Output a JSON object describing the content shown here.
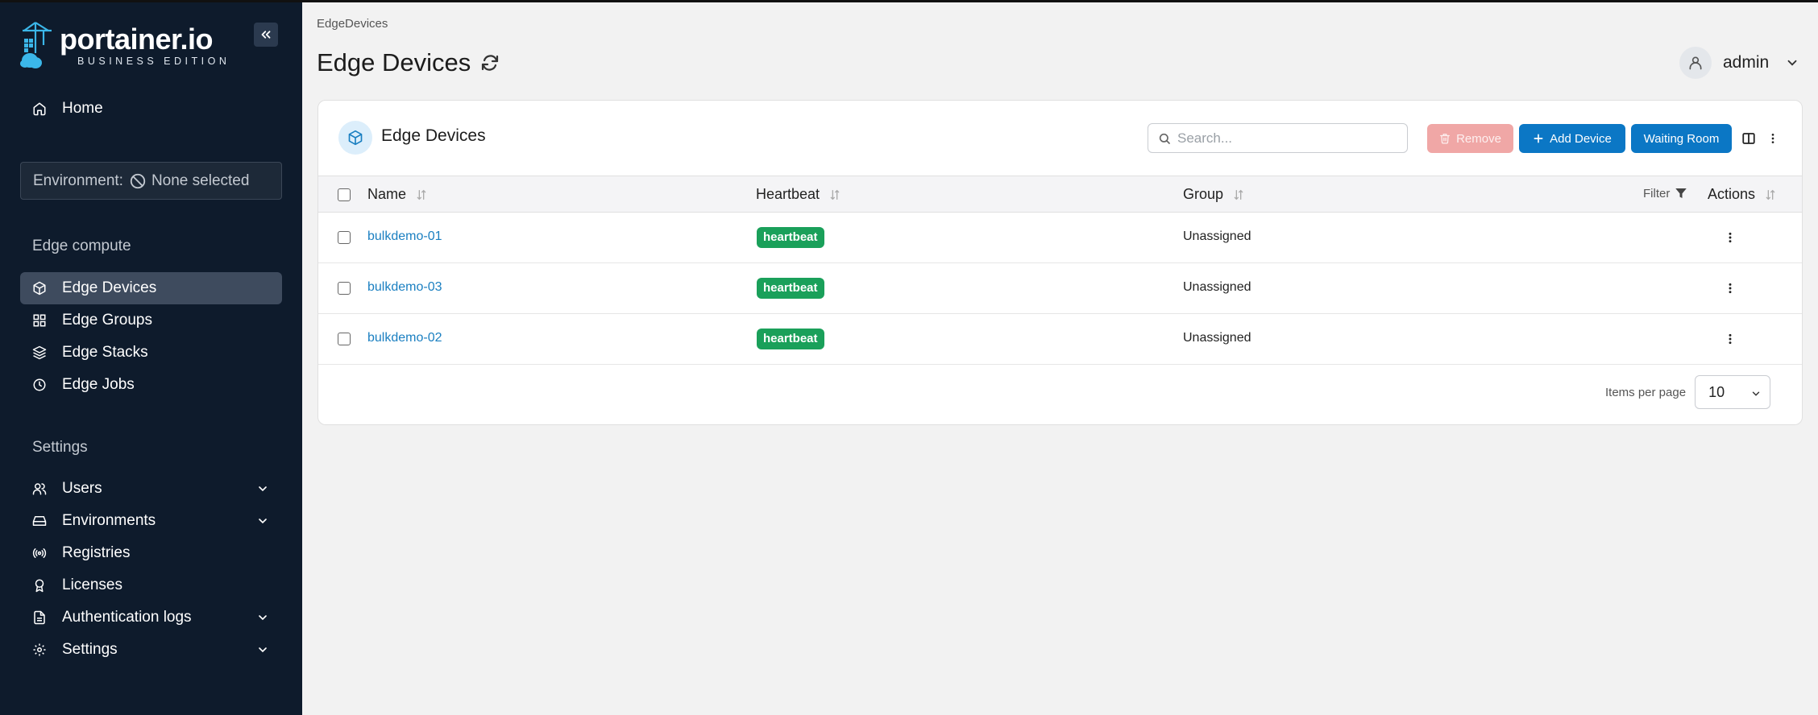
{
  "app": {
    "logo_text": "portainer.io",
    "logo_sub": "BUSINESS EDITION"
  },
  "sidebar": {
    "home_label": "Home",
    "environment_label": "Environment:",
    "environment_value": "None selected",
    "edge_section_label": "Edge compute",
    "edge_items": [
      {
        "label": "Edge Devices",
        "icon": "box-icon",
        "active": true
      },
      {
        "label": "Edge Groups",
        "icon": "grid-icon",
        "active": false
      },
      {
        "label": "Edge Stacks",
        "icon": "layers-icon",
        "active": false
      },
      {
        "label": "Edge Jobs",
        "icon": "clock-icon",
        "active": false
      }
    ],
    "settings_section_label": "Settings",
    "settings_items": [
      {
        "label": "Users",
        "icon": "users-icon",
        "expandable": true
      },
      {
        "label": "Environments",
        "icon": "hard-drive-icon",
        "expandable": true
      },
      {
        "label": "Registries",
        "icon": "radio-icon",
        "expandable": false
      },
      {
        "label": "Licenses",
        "icon": "award-icon",
        "expandable": false
      },
      {
        "label": "Authentication logs",
        "icon": "file-text-icon",
        "expandable": true
      },
      {
        "label": "Settings",
        "icon": "gear-icon",
        "expandable": true
      }
    ]
  },
  "header": {
    "breadcrumb": "EdgeDevices",
    "title": "Edge Devices",
    "user_name": "admin"
  },
  "card": {
    "title": "Edge Devices",
    "search_placeholder": "Search...",
    "remove_label": "Remove",
    "add_device_label": "Add Device",
    "waiting_room_label": "Waiting Room"
  },
  "table": {
    "columns": {
      "name": "Name",
      "heartbeat": "Heartbeat",
      "group": "Group",
      "filter": "Filter",
      "actions": "Actions"
    },
    "rows": [
      {
        "name": "bulkdemo-01",
        "heartbeat": "heartbeat",
        "group": "Unassigned"
      },
      {
        "name": "bulkdemo-03",
        "heartbeat": "heartbeat",
        "group": "Unassigned"
      },
      {
        "name": "bulkdemo-02",
        "heartbeat": "heartbeat",
        "group": "Unassigned"
      }
    ]
  },
  "pagination": {
    "items_per_page_label": "Items per page",
    "items_per_page_value": "10"
  },
  "colors": {
    "sidebar_bg": "#0e1b2c",
    "primary": "#0b77c5",
    "heartbeat_badge": "#1aa05a",
    "remove_disabled": "#f0a7a6"
  }
}
